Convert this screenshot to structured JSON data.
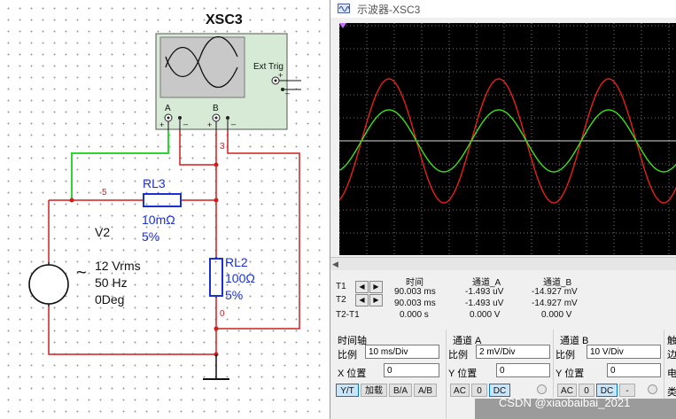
{
  "schematic": {
    "scope_ref": "XSC3",
    "ext_trig_label": "Ext Trig",
    "pins": {
      "a": "A",
      "b": "B",
      "plus": "+",
      "minus": "_"
    },
    "source": {
      "ref": "V2",
      "voltage": "12 Vrms",
      "frequency": "50 Hz",
      "phase": "0Deg",
      "tilde": "~"
    },
    "resistor_rl3": {
      "ref": "RL3",
      "value": "10mΩ",
      "tolerance": "5%"
    },
    "resistor_rl2": {
      "ref": "RL2",
      "value": "100Ω",
      "tolerance": "5%"
    },
    "nets": {
      "net5": "5",
      "net3": "3",
      "net0": "0"
    }
  },
  "scope_window": {
    "title": "示波器-XSC3",
    "wave_colors": {
      "channel_a": "#e8201c",
      "channel_b": "#3ee01a"
    },
    "readout": {
      "headers": [
        "时间",
        "通道_A",
        "通道_B"
      ],
      "rows": [
        {
          "label": "T1",
          "time": "90.003 ms",
          "a": "-1.493 uV",
          "b": "-14.927 mV"
        },
        {
          "label": "T2",
          "time": "90.003 ms",
          "a": "-1.493 uV",
          "b": "-14.927 mV"
        },
        {
          "label": "T2-T1",
          "time": "0.000 s",
          "a": "0.000 V",
          "b": "0.000 V"
        }
      ]
    },
    "timebase": {
      "heading": "时间轴",
      "scale_label": "比例",
      "scale_value": "10 ms/Div",
      "pos_label": "X 位置",
      "pos_value": "0",
      "buttons": [
        "Y/T",
        "加载",
        "B/A",
        "A/B"
      ]
    },
    "channel_a": {
      "heading": "通道 A",
      "scale_label": "比例",
      "scale_value": "2 mV/Div",
      "pos_label": "Y 位置",
      "pos_value": "0",
      "buttons": [
        "AC",
        "0",
        "DC"
      ]
    },
    "channel_b": {
      "heading": "通道 B",
      "scale_label": "比例",
      "scale_value": "10  V/Div",
      "pos_label": "Y 位置",
      "pos_value": "0",
      "buttons": [
        "AC",
        "0",
        "DC",
        "-"
      ]
    },
    "trigger": {
      "heading": "触",
      "edge_label": "边",
      "level_label": "电",
      "type_label": "类"
    }
  },
  "watermark": "CSDN @xiaobaibai_2021"
}
